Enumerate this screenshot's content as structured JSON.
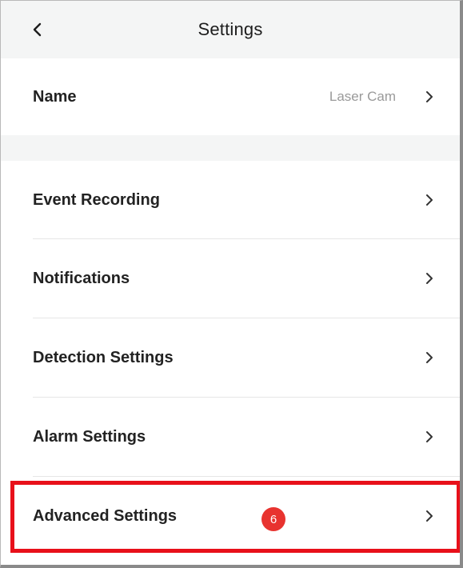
{
  "header": {
    "title": "Settings",
    "back_icon": "chevron-left-icon"
  },
  "name_row": {
    "label": "Name",
    "value": "Laser Cam"
  },
  "settings_rows": [
    {
      "label": "Event Recording"
    },
    {
      "label": "Notifications"
    },
    {
      "label": "Detection Settings"
    },
    {
      "label": "Alarm Settings"
    },
    {
      "label": "Advanced Settings"
    }
  ],
  "annotation": {
    "step_number": "6",
    "highlight_color": "#e8101a",
    "badge_color": "#e8332f"
  },
  "colors": {
    "background": "#f4f5f5",
    "card": "#ffffff",
    "text": "#222222",
    "muted": "#9a9a9a"
  }
}
